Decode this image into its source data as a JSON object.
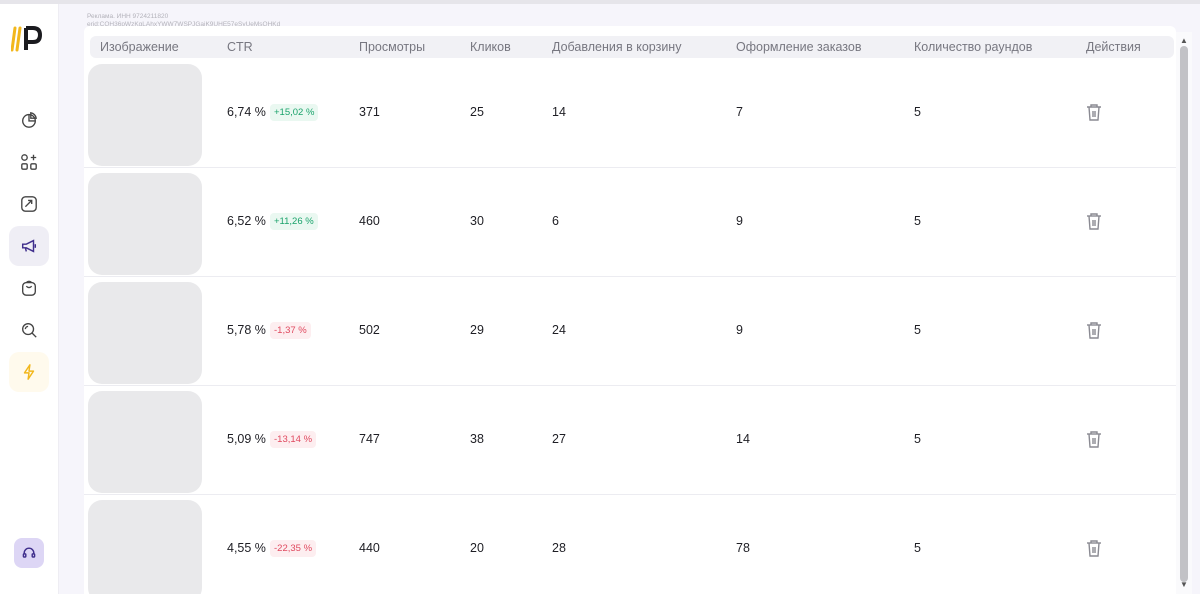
{
  "ad_note": {
    "line1": "Реклама. ИНН 9724211820",
    "line2": "erid:CQH36pWzKgLAhxYWW7WSPJGajK9UHE57eSyUeMsQHKd"
  },
  "sidebar": {
    "items": [
      {
        "icon": "pie-chart-icon"
      },
      {
        "icon": "apps-icon"
      },
      {
        "icon": "trend-icon"
      },
      {
        "icon": "megaphone-icon",
        "active": true
      },
      {
        "icon": "bag-icon"
      },
      {
        "icon": "search-icon"
      },
      {
        "icon": "lightning-icon",
        "highlight": true
      }
    ],
    "support_icon": "headset-icon"
  },
  "colors": {
    "accent": "#7b5cd6",
    "brand_yellow": "#f2b71c",
    "positive": "#1aa36b",
    "negative": "#e0495f"
  },
  "table": {
    "headers": [
      "Изображение",
      "CTR",
      "Просмотры",
      "Кликов",
      "Добавления в корзину",
      "Оформление заказов",
      "Количество раундов",
      "Действия"
    ],
    "rows": [
      {
        "ctr": "6,74 %",
        "delta": "+15,02 %",
        "trend": "pos",
        "views": "371",
        "clicks": "25",
        "cart": "14",
        "orders": "7",
        "rounds": "5"
      },
      {
        "ctr": "6,52 %",
        "delta": "+11,26 %",
        "trend": "pos",
        "views": "460",
        "clicks": "30",
        "cart": "6",
        "orders": "9",
        "rounds": "5"
      },
      {
        "ctr": "5,78 %",
        "delta": "-1,37 %",
        "trend": "neg",
        "views": "502",
        "clicks": "29",
        "cart": "24",
        "orders": "9",
        "rounds": "5"
      },
      {
        "ctr": "5,09 %",
        "delta": "-13,14 %",
        "trend": "neg",
        "views": "747",
        "clicks": "38",
        "cart": "27",
        "orders": "14",
        "rounds": "5"
      },
      {
        "ctr": "4,55 %",
        "delta": "-22,35 %",
        "trend": "neg",
        "views": "440",
        "clicks": "20",
        "cart": "28",
        "orders": "78",
        "rounds": "5"
      }
    ]
  }
}
